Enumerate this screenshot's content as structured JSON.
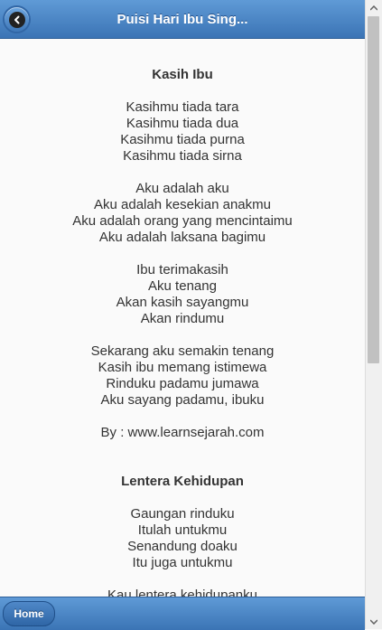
{
  "header": {
    "title": "Puisi Hari Ibu Sing..."
  },
  "poems": [
    {
      "title": "Kasih Ibu",
      "stanzas": [
        [
          "Kasihmu tiada tara",
          "Kasihmu tiada dua",
          "Kasihmu tiada purna",
          "Kasihmu tiada sirna"
        ],
        [
          "Aku adalah aku",
          "Aku adalah kesekian anakmu",
          "Aku adalah orang yang mencintaimu",
          "Aku adalah laksana bagimu"
        ],
        [
          "Ibu terimakasih",
          "Aku tenang",
          "Akan kasih sayangmu",
          "Akan rindumu"
        ],
        [
          "Sekarang aku semakin tenang",
          "Kasih ibu memang istimewa",
          "Rinduku padamu jumawa",
          "Aku sayang padamu, ibuku"
        ]
      ],
      "byline": "By : www.learnsejarah.com"
    },
    {
      "title": "Lentera Kehidupan",
      "stanzas": [
        [
          "Gaungan rinduku",
          "Itulah untukmu",
          "Senandung doaku",
          "Itu juga untukmu"
        ],
        [
          "Kau lentera kehidupanku"
        ]
      ]
    }
  ],
  "footer": {
    "home_label": "Home"
  },
  "colors": {
    "bar_top": "#5f9ad6",
    "bar_bottom": "#3b74b5",
    "background": "#fafafa",
    "text": "#333333"
  }
}
